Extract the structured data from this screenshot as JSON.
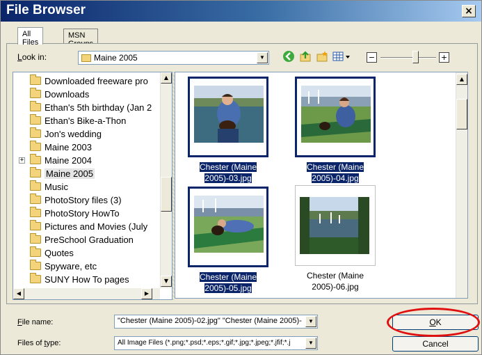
{
  "window": {
    "title": "File Browser",
    "close_label": "×"
  },
  "tabs": [
    {
      "label": "All Files"
    },
    {
      "label": "MSN Groups"
    }
  ],
  "toolbar": {
    "look_in_label": "Look in:",
    "look_in_access_key": "L",
    "look_in_rest": "ook in:",
    "look_in_value": "Maine 2005",
    "icons": [
      "back-icon",
      "up-folder-icon",
      "new-folder-icon",
      "views-menu-icon"
    ],
    "zoom_out_label": "−",
    "zoom_in_label": "+",
    "zoom_level": 0.58
  },
  "folder_tree": {
    "items": [
      {
        "label": "Downloaded freeware pro",
        "expandable": false
      },
      {
        "label": "Downloads",
        "expandable": false
      },
      {
        "label": "Ethan's 5th birthday (Jan 2",
        "expandable": false
      },
      {
        "label": "Ethan's Bike-a-Thon",
        "expandable": false
      },
      {
        "label": "Jon's wedding",
        "expandable": false
      },
      {
        "label": "Maine 2003",
        "expandable": false
      },
      {
        "label": "Maine 2004",
        "expandable": true,
        "expander": "+"
      },
      {
        "label": "Maine 2005",
        "expandable": false,
        "selected": true
      },
      {
        "label": "Music",
        "expandable": false
      },
      {
        "label": "PhotoStory files (3)",
        "expandable": false
      },
      {
        "label": "PhotoStory HowTo",
        "expandable": false
      },
      {
        "label": "Pictures and Movies (July",
        "expandable": false
      },
      {
        "label": "PreSchool Graduation",
        "expandable": false
      },
      {
        "label": "Quotes",
        "expandable": false
      },
      {
        "label": "Spyware, etc",
        "expandable": false
      },
      {
        "label": "SUNY How To pages",
        "expandable": false
      }
    ]
  },
  "thumbnails": [
    {
      "line1": "Chester (Maine",
      "line2": "2005)-03.jpg",
      "selected": true
    },
    {
      "line1": "Chester (Maine",
      "line2": "2005)-04.jpg",
      "selected": true
    },
    {
      "line1": "Chester (Maine",
      "line2": "2005)-05.jpg",
      "selected": true
    },
    {
      "line1": "Chester (Maine",
      "line2": "2005)-06.jpg",
      "selected": false
    }
  ],
  "footer": {
    "file_name_label": "File name:",
    "file_name_access_key": "F",
    "file_name_rest": "ile name:",
    "file_name_value": "\"Chester (Maine 2005)-02.jpg\" \"Chester (Maine 2005)-",
    "file_type_label": "Files of type:",
    "file_type_prefix": "Files of ",
    "file_type_access_key": "t",
    "file_type_rest": "ype:",
    "file_type_value": "All Image Files (*.png;*.psd;*.eps;*.gif;*.jpg;*.jpeg;*.jfif;*.j",
    "ok_label": "OK",
    "ok_access_key": "O",
    "ok_rest": "K",
    "cancel_label": "Cancel"
  },
  "colors": {
    "title_start": "#0a246a",
    "selection": "#0a246a",
    "annotation_circle": "#e01010"
  }
}
